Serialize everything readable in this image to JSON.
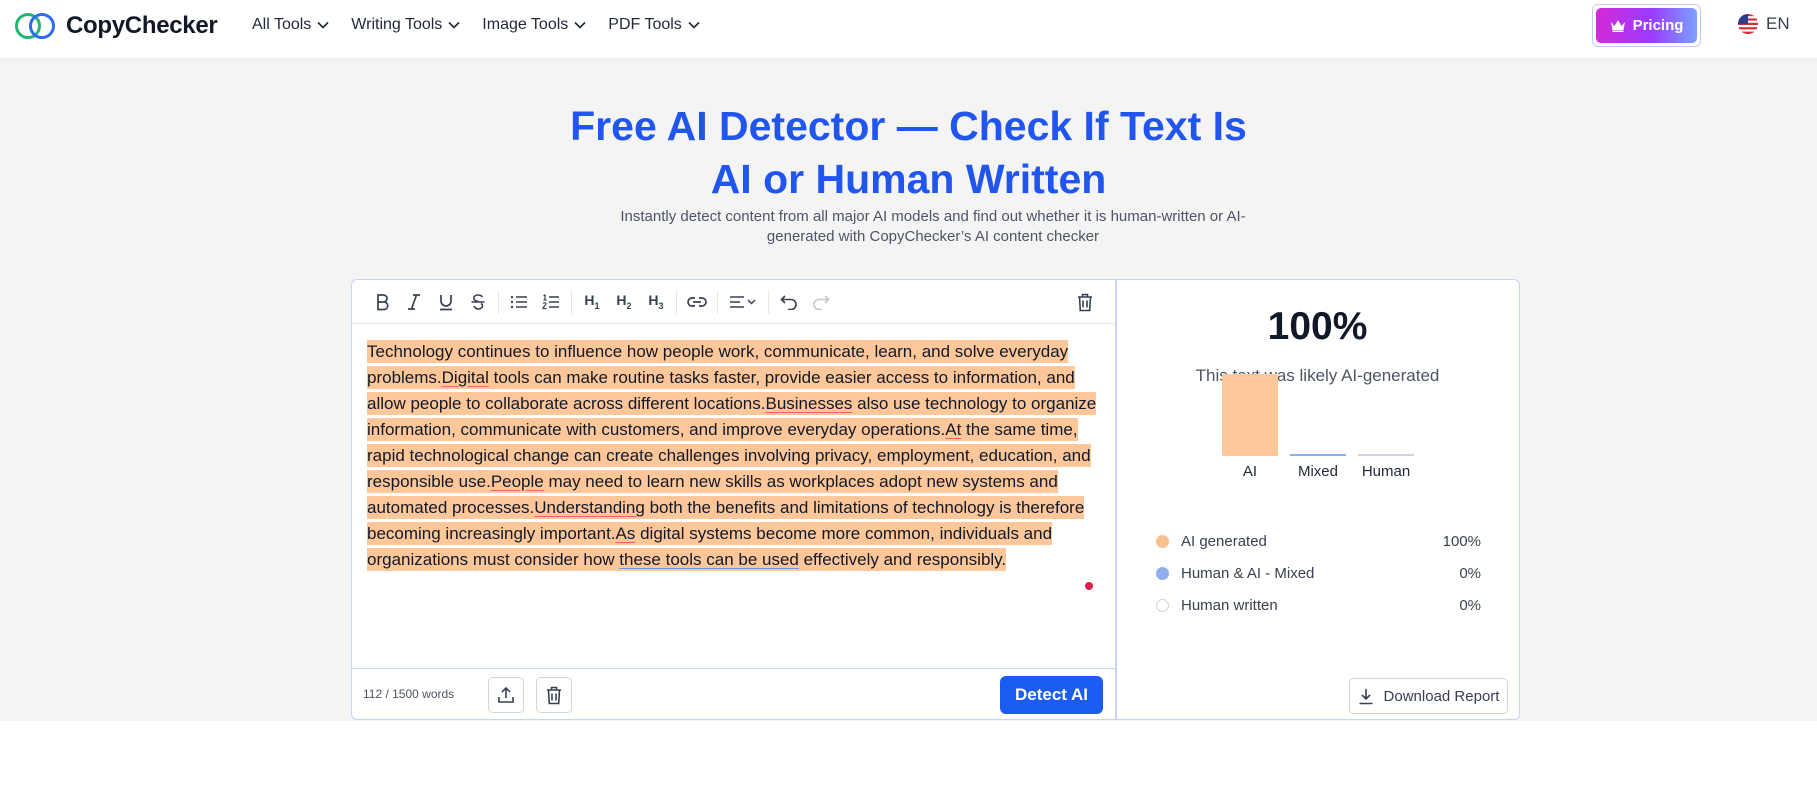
{
  "header": {
    "logo_text": "CopyChecker",
    "nav": [
      {
        "label": "All Tools"
      },
      {
        "label": "Writing Tools"
      },
      {
        "label": "Image Tools"
      },
      {
        "label": "PDF Tools"
      }
    ],
    "pricing_label": "Pricing",
    "language": "EN"
  },
  "hero": {
    "title_line1": "Free AI Detector — Check If Text Is",
    "title_line2": "AI or Human Written",
    "subtitle": "Instantly detect content from all major AI models and find out whether it is human-written or AI-generated with CopyChecker’s AI content checker"
  },
  "editor": {
    "toolbar": [
      "bold-icon",
      "italic-icon",
      "underline-icon",
      "strikethrough-icon",
      "bullet-list-icon",
      "numbered-list-icon",
      "heading-1",
      "heading-2",
      "heading-3",
      "link-icon",
      "align-icon",
      "undo-icon",
      "redo-icon",
      "trash-icon"
    ],
    "text_segments": [
      {
        "t": "Technology continues to influence how people work, communicate, learn, and solve everyday problems.",
        "u": ""
      },
      {
        "t": "Digital",
        "u": "red"
      },
      {
        "t": " tools can make routine tasks faster, provide easier access to information, and allow people to collaborate across different locations.",
        "u": ""
      },
      {
        "t": "Businesses",
        "u": "red"
      },
      {
        "t": " also use technology to organize information, communicate with customers, and improve everyday operations.",
        "u": ""
      },
      {
        "t": "At",
        "u": "red"
      },
      {
        "t": " the same time, rapid technological change can create challenges involving privacy, employment, education, and responsible use.",
        "u": ""
      },
      {
        "t": "People",
        "u": "red"
      },
      {
        "t": " may need to learn new skills as workplaces adopt new systems and automated processes.",
        "u": ""
      },
      {
        "t": "Understanding",
        "u": "red"
      },
      {
        "t": " both the benefits and limitations of technology is therefore becoming increasingly important.",
        "u": ""
      },
      {
        "t": "As",
        "u": "red"
      },
      {
        "t": " digital systems become more common, individuals and organizations must consider how ",
        "u": ""
      },
      {
        "t": "these tools can be used",
        "u": "blue"
      },
      {
        "t": " effectively and responsibly.",
        "u": ""
      }
    ],
    "word_count": "112 / 1500 words",
    "detect_label": "Detect AI"
  },
  "result": {
    "percent": "100%",
    "verdict": "This text was likely AI-generated",
    "chart_data": {
      "type": "bar",
      "categories": [
        "AI",
        "Mixed",
        "Human"
      ],
      "values": [
        100,
        0,
        0
      ],
      "colors": [
        "#fdc799",
        "#8fb0ec",
        "#d1d5db"
      ],
      "ylim": [
        0,
        100
      ]
    },
    "legend": [
      {
        "label": "AI generated",
        "value": "100%",
        "color": "#f7c08e"
      },
      {
        "label": "Human & AI - Mixed",
        "value": "0%",
        "color": "#8fb0ec"
      },
      {
        "label": "Human written",
        "value": "0%",
        "color": "#ffffff"
      }
    ],
    "download_label": "Download Report"
  }
}
